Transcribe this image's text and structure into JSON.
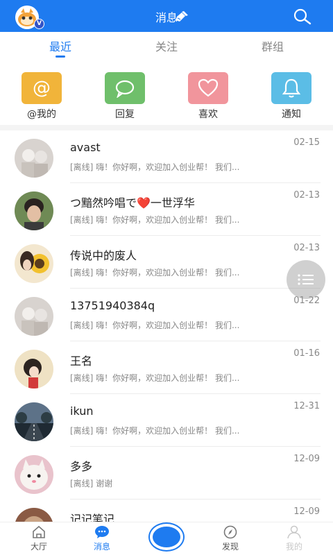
{
  "header": {
    "title": "消息",
    "vip_badge": "V"
  },
  "tabs": [
    {
      "label": "最近",
      "active": true
    },
    {
      "label": "关注",
      "active": false
    },
    {
      "label": "群组",
      "active": false
    }
  ],
  "shortcuts": [
    {
      "label": "@我的",
      "icon": "at-icon",
      "color": "#f1b43a"
    },
    {
      "label": "回复",
      "icon": "chat-bubble-icon",
      "color": "#6fbf6b"
    },
    {
      "label": "喜欢",
      "icon": "heart-icon",
      "color": "#f1959c"
    },
    {
      "label": "通知",
      "icon": "bell-icon",
      "color": "#5bbde6"
    }
  ],
  "messages": [
    {
      "name": "avast",
      "preview": "[离线] 嗨！你好啊，欢迎加入创业帮！ 我们...",
      "time": "02-15",
      "avatar": "sketch-avatar"
    },
    {
      "name": "つ黯然吟唱で❤️一世浮华",
      "preview": "[离线] 嗨！你好啊，欢迎加入创业帮！ 我们...",
      "time": "02-13",
      "avatar": "person-avatar"
    },
    {
      "name": "传说中的废人",
      "preview": "[离线] 嗨！你好啊，欢迎加入创业帮！ 我们...",
      "time": "02-13",
      "avatar": "sunflower-avatar"
    },
    {
      "name": "13751940384q",
      "preview": "[离线] 嗨！你好啊，欢迎加入创业帮！ 我们...",
      "time": "01-22",
      "avatar": "sketch-avatar"
    },
    {
      "name": "王名",
      "preview": "[离线] 嗨！你好啊，欢迎加入创业帮！ 我们...",
      "time": "01-16",
      "avatar": "girl-illustration-avatar"
    },
    {
      "name": "ikun",
      "preview": "[离线] 嗨！你好啊，欢迎加入创业帮！ 我们...",
      "time": "12-31",
      "avatar": "road-avatar"
    },
    {
      "name": "多多",
      "preview": "[离线] 谢谢",
      "time": "12-09",
      "avatar": "cat-avatar"
    },
    {
      "name": "记记笔记",
      "preview": "",
      "time": "12-09",
      "avatar": "brown-avatar"
    }
  ],
  "bottom_nav": [
    {
      "label": "大厅",
      "icon": "home-icon"
    },
    {
      "label": "消息",
      "icon": "message-icon",
      "active": true
    },
    {
      "label": "发现",
      "icon": "compass-icon"
    },
    {
      "label": "我的",
      "icon": "user-icon",
      "disabled": true
    }
  ],
  "colors": {
    "primary": "#1e7bf0"
  }
}
